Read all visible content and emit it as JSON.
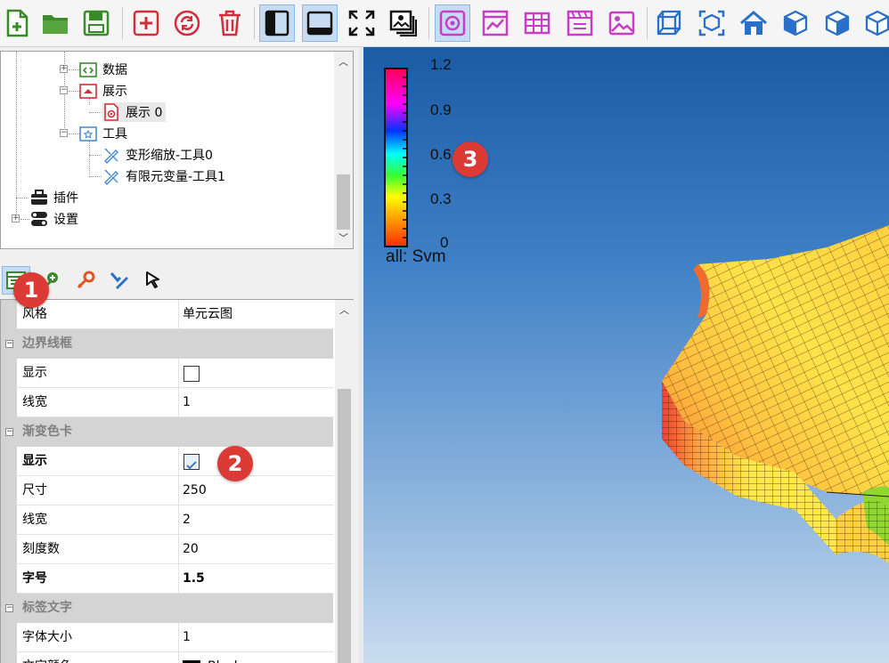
{
  "toolbar": {
    "buttons": [
      {
        "name": "new-file-icon"
      },
      {
        "name": "open-folder-icon"
      },
      {
        "name": "save-icon"
      },
      {
        "name": "add-icon"
      },
      {
        "name": "refresh-icon"
      },
      {
        "name": "delete-icon"
      },
      {
        "name": "panel-left-icon",
        "active": true
      },
      {
        "name": "panel-bottom-icon",
        "active": true
      },
      {
        "name": "fullscreen-icon"
      },
      {
        "name": "screenshot-icon"
      },
      {
        "name": "cloud-view-icon",
        "active": true
      },
      {
        "name": "chart-icon"
      },
      {
        "name": "table-icon"
      },
      {
        "name": "film-icon"
      },
      {
        "name": "image-icon"
      },
      {
        "name": "view-wireframe-icon"
      },
      {
        "name": "view-fit-icon"
      },
      {
        "name": "home-view-icon"
      },
      {
        "name": "cube-front-icon"
      },
      {
        "name": "cube-side-icon"
      },
      {
        "name": "cube-top-icon"
      }
    ]
  },
  "tree": {
    "items": [
      {
        "label": "数据"
      },
      {
        "label": "展示"
      },
      {
        "label": "展示 0"
      },
      {
        "label": "工具"
      },
      {
        "label": "变形缩放-工具0"
      },
      {
        "label": "有限元变量-工具1"
      },
      {
        "label": "插件"
      },
      {
        "label": "设置"
      }
    ]
  },
  "property_toolbar": {
    "buttons": [
      {
        "name": "property-grid-icon",
        "active": true
      },
      {
        "name": "add-probe-icon"
      },
      {
        "name": "pick-tool-icon"
      },
      {
        "name": "edit-tool-icon"
      },
      {
        "name": "cursor-icon"
      }
    ]
  },
  "properties": {
    "rows": [
      {
        "type": "prop",
        "name": "风格",
        "value": "单元云图"
      },
      {
        "type": "cat",
        "name": "边界线框"
      },
      {
        "type": "prop",
        "name": "显示",
        "value": "",
        "checkbox": false
      },
      {
        "type": "prop",
        "name": "线宽",
        "value": "1"
      },
      {
        "type": "cat",
        "name": "渐变色卡"
      },
      {
        "type": "prop",
        "name": "显示",
        "value": "",
        "checkbox": true,
        "bold": true
      },
      {
        "type": "prop",
        "name": "尺寸",
        "value": "250"
      },
      {
        "type": "prop",
        "name": "线宽",
        "value": "2"
      },
      {
        "type": "prop",
        "name": "刻度数",
        "value": "20"
      },
      {
        "type": "prop",
        "name": "字号",
        "value": "1.5",
        "bold": true
      },
      {
        "type": "cat",
        "name": "标签文字"
      },
      {
        "type": "prop",
        "name": "字体大小",
        "value": "1"
      },
      {
        "type": "prop",
        "name": "文字颜色",
        "value": "Black",
        "swatch": "#000000"
      }
    ]
  },
  "legend": {
    "ticks": [
      "1.2",
      "0.9",
      "0.6",
      "0.3",
      "0"
    ],
    "caption": "all: Svm"
  },
  "badges": [
    "1",
    "2",
    "3"
  ]
}
